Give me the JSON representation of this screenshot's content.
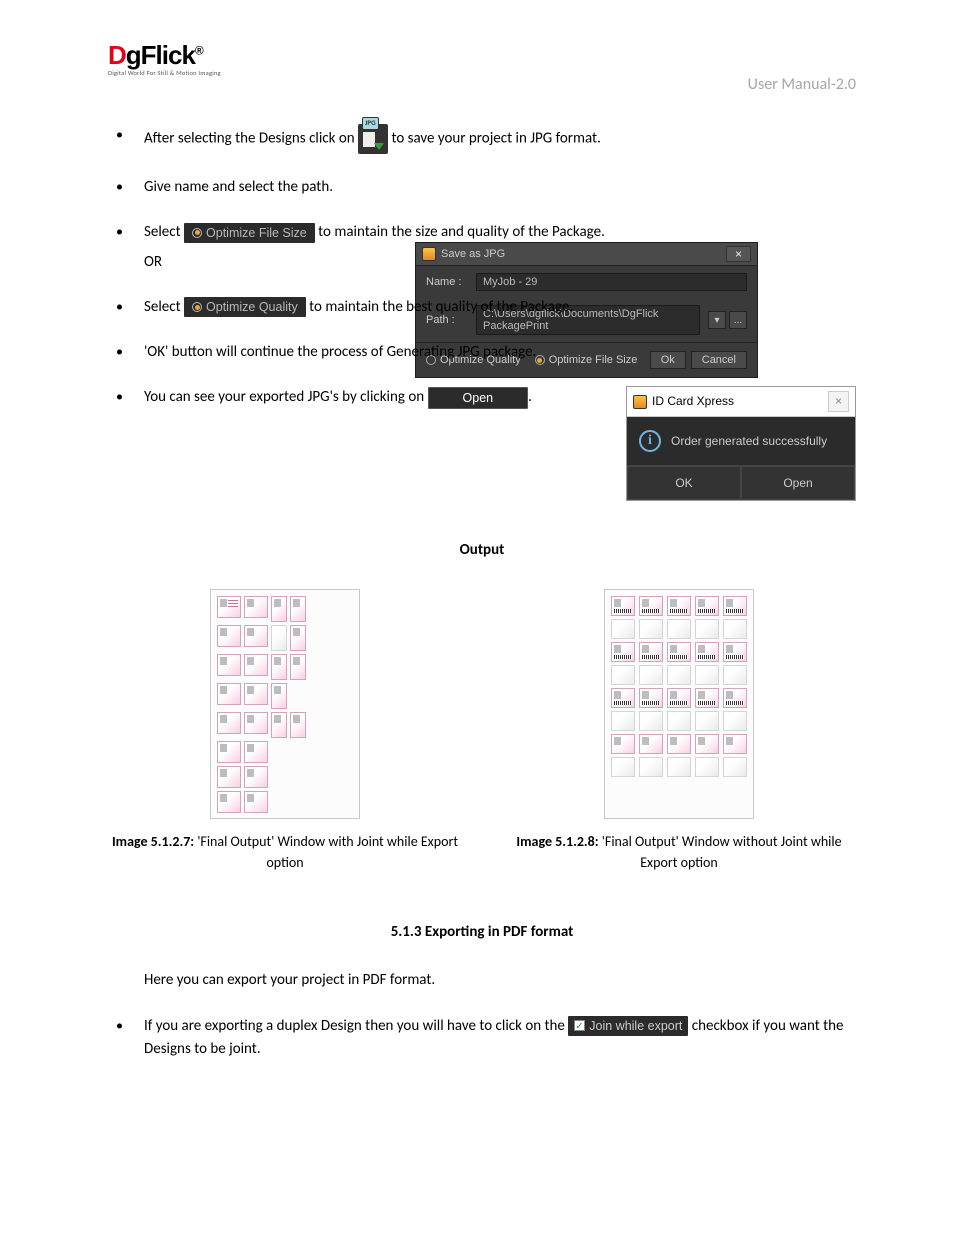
{
  "header": {
    "brand_d": "D",
    "brand_rest": "gFlick",
    "brand_sub": "Digital World For Still & Motion Imaging",
    "manual": "User Manual-2.0"
  },
  "bullets": {
    "b1a": "After selecting the Designs click on ",
    "b1b": " to save your project in JPG format.",
    "b2": "Give name and select the path.",
    "b3a": "Select ",
    "b3_optfs": "Optimize File Size",
    "b3b": " to maintain the size and quality of the Package.",
    "b3_or": "OR",
    "b4a": "Select ",
    "b4_optq": "Optimize Quality",
    "b4b": " to maintain the best quality of the Package.",
    "b5": "'OK' button will continue the process of Generating JPG package.",
    "b6a": "You can see your exported JPG's by clicking on ",
    "b6_open": "Open",
    "b6b": "."
  },
  "save_dialog": {
    "title": "Save as JPG",
    "close": "×",
    "name_lbl": "Name :",
    "name_val": "MyJob - 29",
    "path_lbl": "Path :",
    "path_val": "C:\\Users\\dgflick\\Documents\\DgFlick PackagePrint",
    "dropdown": "▾",
    "browse": "...",
    "opt_q": "Optimize Quality",
    "opt_fs": "Optimize File Size",
    "ok": "Ok",
    "cancel": "Cancel"
  },
  "success_dialog": {
    "title": "ID Card Xpress",
    "close": "×",
    "info": "i",
    "msg": "Order generated successfully",
    "ok": "OK",
    "open": "Open"
  },
  "output": {
    "heading": "Output",
    "cap1b": "Image 5.1.2.7:",
    "cap1": "  'Final Output' Window with Joint while Export option",
    "cap2b": "Image 5.1.2.8:",
    "cap2": "  'Final Output' Window without Joint while Export option"
  },
  "section": {
    "heading": "5.1.3 Exporting in PDF format",
    "p1": "Here you can export your project in PDF format.",
    "li1a": "If you are exporting a duplex Design then you will have to click on the ",
    "li1_join": "Join while export",
    "li1b": " checkbox if you want the Designs to be joint."
  }
}
